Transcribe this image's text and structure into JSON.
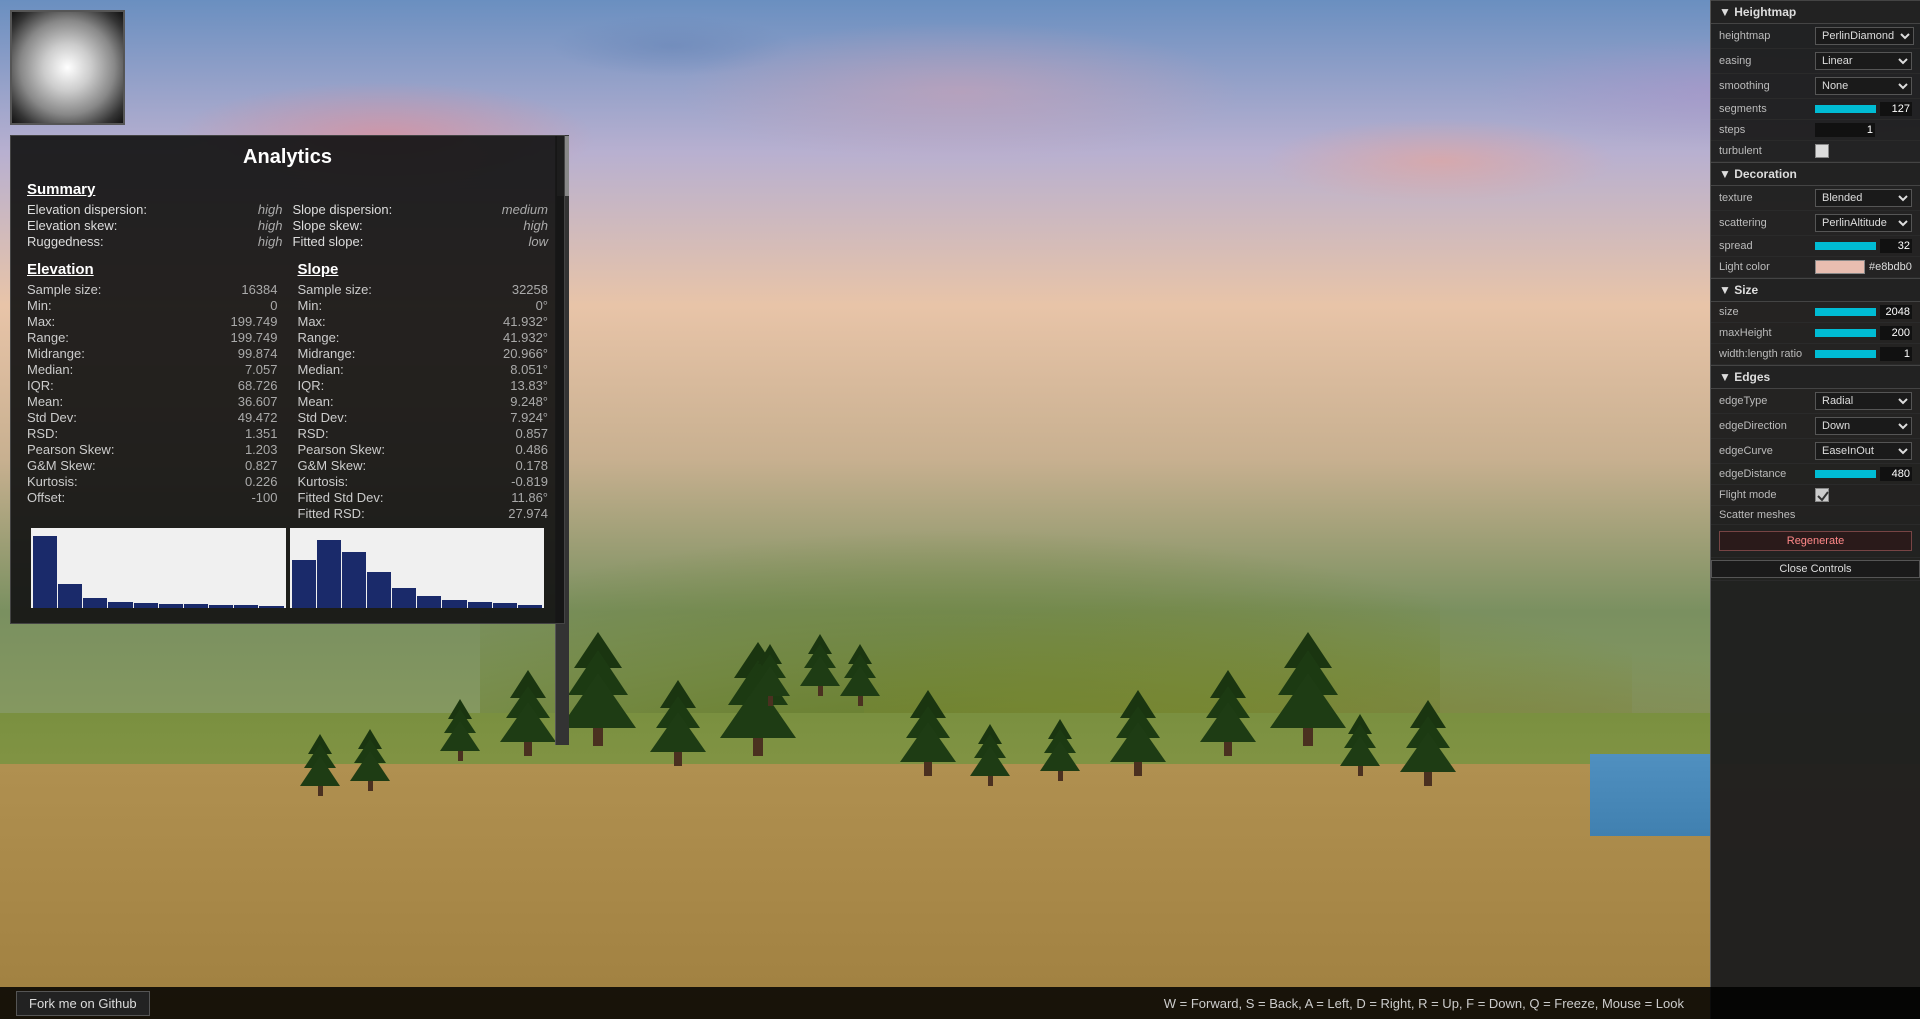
{
  "viewport": {
    "alt": "3D terrain view with trees and hills"
  },
  "heightmap_preview": {
    "alt": "Heightmap preview thumbnail"
  },
  "analytics": {
    "title": "Analytics",
    "summary_header": "Summary",
    "summary_items": [
      {
        "label": "Elevation dispersion:",
        "value": "high"
      },
      {
        "label": "Slope dispersion:",
        "value": "medium"
      },
      {
        "label": "Elevation skew:",
        "value": "high"
      },
      {
        "label": "Slope skew:",
        "value": "high"
      },
      {
        "label": "Ruggedness:",
        "value": "high"
      },
      {
        "label": "Fitted slope:",
        "value": "low"
      }
    ],
    "elevation_header": "Elevation",
    "slope_header": "Slope",
    "elevation_stats": [
      {
        "label": "Sample size:",
        "value": "16384"
      },
      {
        "label": "Min:",
        "value": "0"
      },
      {
        "label": "Max:",
        "value": "199.749"
      },
      {
        "label": "Range:",
        "value": "199.749"
      },
      {
        "label": "Midrange:",
        "value": "99.874"
      },
      {
        "label": "Median:",
        "value": "7.057"
      },
      {
        "label": "IQR:",
        "value": "68.726"
      },
      {
        "label": "Mean:",
        "value": "36.607"
      },
      {
        "label": "Std Dev:",
        "value": "49.472"
      },
      {
        "label": "RSD:",
        "value": "1.351"
      },
      {
        "label": "Pearson Skew:",
        "value": "1.203"
      },
      {
        "label": "G&M Skew:",
        "value": "0.827"
      },
      {
        "label": "Kurtosis:",
        "value": "0.226"
      },
      {
        "label": "Offset:",
        "value": "-100"
      }
    ],
    "slope_stats": [
      {
        "label": "Sample size:",
        "value": "32258"
      },
      {
        "label": "Min:",
        "value": "0°"
      },
      {
        "label": "Max:",
        "value": "41.932°"
      },
      {
        "label": "Range:",
        "value": "41.932°"
      },
      {
        "label": "Midrange:",
        "value": "20.966°"
      },
      {
        "label": "Median:",
        "value": "8.051°"
      },
      {
        "label": "IQR:",
        "value": "13.83°"
      },
      {
        "label": "Mean:",
        "value": "9.248°"
      },
      {
        "label": "Std Dev:",
        "value": "7.924°"
      },
      {
        "label": "RSD:",
        "value": "0.857"
      },
      {
        "label": "Pearson Skew:",
        "value": "0.486"
      },
      {
        "label": "G&M Skew:",
        "value": "0.178"
      },
      {
        "label": "Kurtosis:",
        "value": "-0.819"
      },
      {
        "label": "Fitted Std Dev:",
        "value": "11.86°"
      },
      {
        "label": "Fitted RSD:",
        "value": "27.974"
      }
    ]
  },
  "right_panel": {
    "heightmap_section": "▼ Heightmap",
    "heightmap_label": "heightmap",
    "heightmap_value": "PerlinDiamond",
    "easing_label": "easing",
    "easing_value": "Linear",
    "smoothing_label": "smoothing",
    "smoothing_value": "None",
    "segments_label": "segments",
    "segments_value": "127",
    "steps_label": "steps",
    "steps_value": "1",
    "turbulent_label": "turbulent",
    "decoration_section": "▼ Decoration",
    "texture_label": "texture",
    "texture_value": "Blended",
    "scattering_label": "scattering",
    "scattering_value": "PerlinAltitude",
    "spread_label": "spread",
    "spread_value": "32",
    "light_color_label": "Light color",
    "light_color_value": "#e8bdb0",
    "size_section": "▼ Size",
    "size_label": "size",
    "size_value": "2048",
    "max_height_label": "maxHeight",
    "max_height_value": "200",
    "width_length_label": "width:length ratio",
    "width_length_value": "1",
    "edges_section": "▼ Edges",
    "edge_type_label": "edgeType",
    "edge_type_value": "Radial",
    "edge_direction_label": "edgeDirection",
    "edge_direction_value": "Down",
    "edge_curve_label": "edgeCurve",
    "edge_curve_value": "EaseInOut",
    "edge_distance_label": "edgeDistance",
    "edge_distance_value": "480",
    "flight_mode_label": "Flight mode",
    "scatter_meshes_label": "Scatter meshes",
    "regenerate_label": "Regenerate",
    "close_controls_label": "Close Controls"
  },
  "bottom_bar": {
    "fork_button": "Fork me on Github",
    "keybindings": "W = Forward, S = Back, A = Left, D = Right, R = Up, F = Down, Q = Freeze, Mouse = Look"
  }
}
